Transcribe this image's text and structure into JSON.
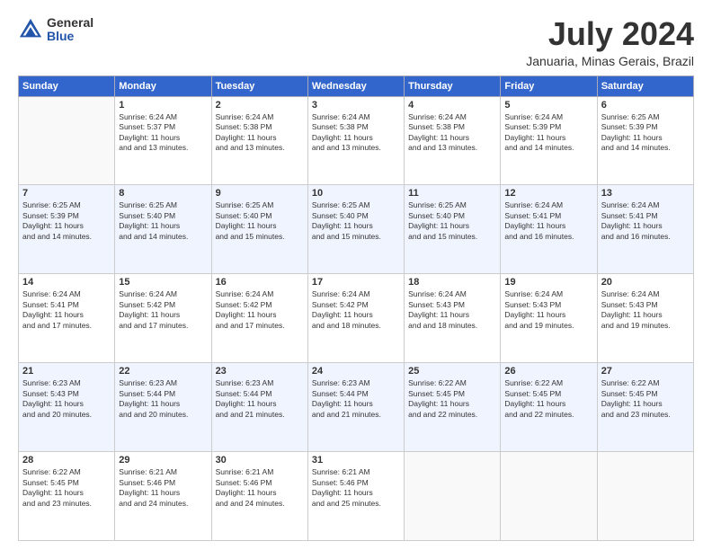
{
  "header": {
    "logo": {
      "general": "General",
      "blue": "Blue"
    },
    "title": "July 2024",
    "location": "Januaria, Minas Gerais, Brazil"
  },
  "weekdays": [
    "Sunday",
    "Monday",
    "Tuesday",
    "Wednesday",
    "Thursday",
    "Friday",
    "Saturday"
  ],
  "weeks": [
    [
      {
        "day": "",
        "sunrise": "",
        "sunset": "",
        "daylight": ""
      },
      {
        "day": "1",
        "sunrise": "Sunrise: 6:24 AM",
        "sunset": "Sunset: 5:37 PM",
        "daylight": "Daylight: 11 hours and 13 minutes."
      },
      {
        "day": "2",
        "sunrise": "Sunrise: 6:24 AM",
        "sunset": "Sunset: 5:38 PM",
        "daylight": "Daylight: 11 hours and 13 minutes."
      },
      {
        "day": "3",
        "sunrise": "Sunrise: 6:24 AM",
        "sunset": "Sunset: 5:38 PM",
        "daylight": "Daylight: 11 hours and 13 minutes."
      },
      {
        "day": "4",
        "sunrise": "Sunrise: 6:24 AM",
        "sunset": "Sunset: 5:38 PM",
        "daylight": "Daylight: 11 hours and 13 minutes."
      },
      {
        "day": "5",
        "sunrise": "Sunrise: 6:24 AM",
        "sunset": "Sunset: 5:39 PM",
        "daylight": "Daylight: 11 hours and 14 minutes."
      },
      {
        "day": "6",
        "sunrise": "Sunrise: 6:25 AM",
        "sunset": "Sunset: 5:39 PM",
        "daylight": "Daylight: 11 hours and 14 minutes."
      }
    ],
    [
      {
        "day": "7",
        "sunrise": "Sunrise: 6:25 AM",
        "sunset": "Sunset: 5:39 PM",
        "daylight": "Daylight: 11 hours and 14 minutes."
      },
      {
        "day": "8",
        "sunrise": "Sunrise: 6:25 AM",
        "sunset": "Sunset: 5:40 PM",
        "daylight": "Daylight: 11 hours and 14 minutes."
      },
      {
        "day": "9",
        "sunrise": "Sunrise: 6:25 AM",
        "sunset": "Sunset: 5:40 PM",
        "daylight": "Daylight: 11 hours and 15 minutes."
      },
      {
        "day": "10",
        "sunrise": "Sunrise: 6:25 AM",
        "sunset": "Sunset: 5:40 PM",
        "daylight": "Daylight: 11 hours and 15 minutes."
      },
      {
        "day": "11",
        "sunrise": "Sunrise: 6:25 AM",
        "sunset": "Sunset: 5:40 PM",
        "daylight": "Daylight: 11 hours and 15 minutes."
      },
      {
        "day": "12",
        "sunrise": "Sunrise: 6:24 AM",
        "sunset": "Sunset: 5:41 PM",
        "daylight": "Daylight: 11 hours and 16 minutes."
      },
      {
        "day": "13",
        "sunrise": "Sunrise: 6:24 AM",
        "sunset": "Sunset: 5:41 PM",
        "daylight": "Daylight: 11 hours and 16 minutes."
      }
    ],
    [
      {
        "day": "14",
        "sunrise": "Sunrise: 6:24 AM",
        "sunset": "Sunset: 5:41 PM",
        "daylight": "Daylight: 11 hours and 17 minutes."
      },
      {
        "day": "15",
        "sunrise": "Sunrise: 6:24 AM",
        "sunset": "Sunset: 5:42 PM",
        "daylight": "Daylight: 11 hours and 17 minutes."
      },
      {
        "day": "16",
        "sunrise": "Sunrise: 6:24 AM",
        "sunset": "Sunset: 5:42 PM",
        "daylight": "Daylight: 11 hours and 17 minutes."
      },
      {
        "day": "17",
        "sunrise": "Sunrise: 6:24 AM",
        "sunset": "Sunset: 5:42 PM",
        "daylight": "Daylight: 11 hours and 18 minutes."
      },
      {
        "day": "18",
        "sunrise": "Sunrise: 6:24 AM",
        "sunset": "Sunset: 5:43 PM",
        "daylight": "Daylight: 11 hours and 18 minutes."
      },
      {
        "day": "19",
        "sunrise": "Sunrise: 6:24 AM",
        "sunset": "Sunset: 5:43 PM",
        "daylight": "Daylight: 11 hours and 19 minutes."
      },
      {
        "day": "20",
        "sunrise": "Sunrise: 6:24 AM",
        "sunset": "Sunset: 5:43 PM",
        "daylight": "Daylight: 11 hours and 19 minutes."
      }
    ],
    [
      {
        "day": "21",
        "sunrise": "Sunrise: 6:23 AM",
        "sunset": "Sunset: 5:43 PM",
        "daylight": "Daylight: 11 hours and 20 minutes."
      },
      {
        "day": "22",
        "sunrise": "Sunrise: 6:23 AM",
        "sunset": "Sunset: 5:44 PM",
        "daylight": "Daylight: 11 hours and 20 minutes."
      },
      {
        "day": "23",
        "sunrise": "Sunrise: 6:23 AM",
        "sunset": "Sunset: 5:44 PM",
        "daylight": "Daylight: 11 hours and 21 minutes."
      },
      {
        "day": "24",
        "sunrise": "Sunrise: 6:23 AM",
        "sunset": "Sunset: 5:44 PM",
        "daylight": "Daylight: 11 hours and 21 minutes."
      },
      {
        "day": "25",
        "sunrise": "Sunrise: 6:22 AM",
        "sunset": "Sunset: 5:45 PM",
        "daylight": "Daylight: 11 hours and 22 minutes."
      },
      {
        "day": "26",
        "sunrise": "Sunrise: 6:22 AM",
        "sunset": "Sunset: 5:45 PM",
        "daylight": "Daylight: 11 hours and 22 minutes."
      },
      {
        "day": "27",
        "sunrise": "Sunrise: 6:22 AM",
        "sunset": "Sunset: 5:45 PM",
        "daylight": "Daylight: 11 hours and 23 minutes."
      }
    ],
    [
      {
        "day": "28",
        "sunrise": "Sunrise: 6:22 AM",
        "sunset": "Sunset: 5:45 PM",
        "daylight": "Daylight: 11 hours and 23 minutes."
      },
      {
        "day": "29",
        "sunrise": "Sunrise: 6:21 AM",
        "sunset": "Sunset: 5:46 PM",
        "daylight": "Daylight: 11 hours and 24 minutes."
      },
      {
        "day": "30",
        "sunrise": "Sunrise: 6:21 AM",
        "sunset": "Sunset: 5:46 PM",
        "daylight": "Daylight: 11 hours and 24 minutes."
      },
      {
        "day": "31",
        "sunrise": "Sunrise: 6:21 AM",
        "sunset": "Sunset: 5:46 PM",
        "daylight": "Daylight: 11 hours and 25 minutes."
      },
      {
        "day": "",
        "sunrise": "",
        "sunset": "",
        "daylight": ""
      },
      {
        "day": "",
        "sunrise": "",
        "sunset": "",
        "daylight": ""
      },
      {
        "day": "",
        "sunrise": "",
        "sunset": "",
        "daylight": ""
      }
    ]
  ]
}
